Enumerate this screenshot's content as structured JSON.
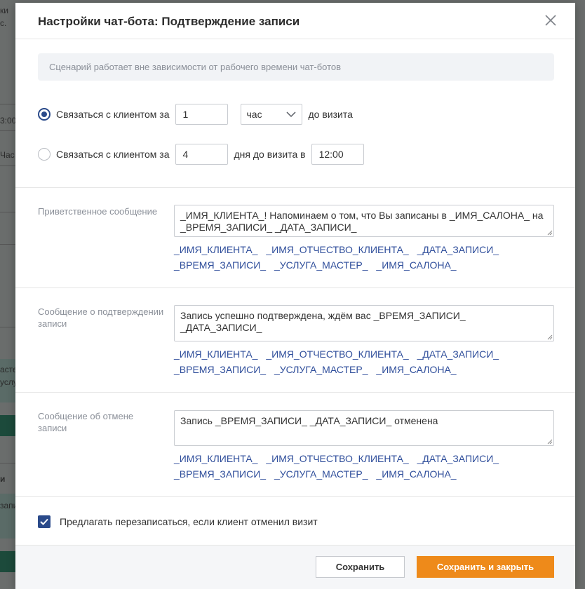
{
  "background": {
    "fragments": [
      "ки",
      "с.",
      "3:00",
      "Час",
      "асте",
      "услу",
      "и",
      "запи"
    ]
  },
  "modal": {
    "title": "Настройки чат-бота: Подтверждение записи",
    "notice": "Сценарий работает вне зависимости от рабочего времени чат-ботов"
  },
  "option1": {
    "label": "Связаться с клиентом за",
    "value": "1",
    "unit_selected": "час",
    "suffix": "до визита",
    "checked": true
  },
  "option2": {
    "label": "Связаться с клиентом за",
    "value": "4",
    "middle": "дня до визита в",
    "time": "12:00",
    "checked": false
  },
  "sections": [
    {
      "label": "Приветственное сообщение",
      "text": "_ИМЯ_КЛИЕНТА_! Напоминаем о том, что Вы записаны в _ИМЯ_САЛОНА_ на _ВРЕМЯ_ЗАПИСИ_ _ДАТА_ЗАПИСИ_"
    },
    {
      "label": "Сообщение о подтверждении записи",
      "text": "Запись успешно подтверждена, ждём вас _ВРЕМЯ_ЗАПИСИ_ _ДАТА_ЗАПИСИ_"
    },
    {
      "label": "Сообщение об отмене записи",
      "text": "Запись _ВРЕМЯ_ЗАПИСИ_ _ДАТА_ЗАПИСИ_ отменена"
    }
  ],
  "tags": [
    "_ИМЯ_КЛИЕНТА_",
    "_ИМЯ_ОТЧЕСТВО_КЛИЕНТА_",
    "_ДАТА_ЗАПИСИ_",
    "_ВРЕМЯ_ЗАПИСИ_",
    "_УСЛУГА_МАСТЕР_",
    "_ИМЯ_САЛОНА_"
  ],
  "rebook": {
    "label": "Предлагать перезаписаться, если клиент отменил визит",
    "checked": true
  },
  "footer": {
    "save_label": "Сохранить",
    "save_close_label": "Сохранить и закрыть"
  },
  "colors": {
    "accent": "#2a4a8a",
    "tag": "#2f4e9b",
    "primary_button": "#ee8a1a"
  }
}
